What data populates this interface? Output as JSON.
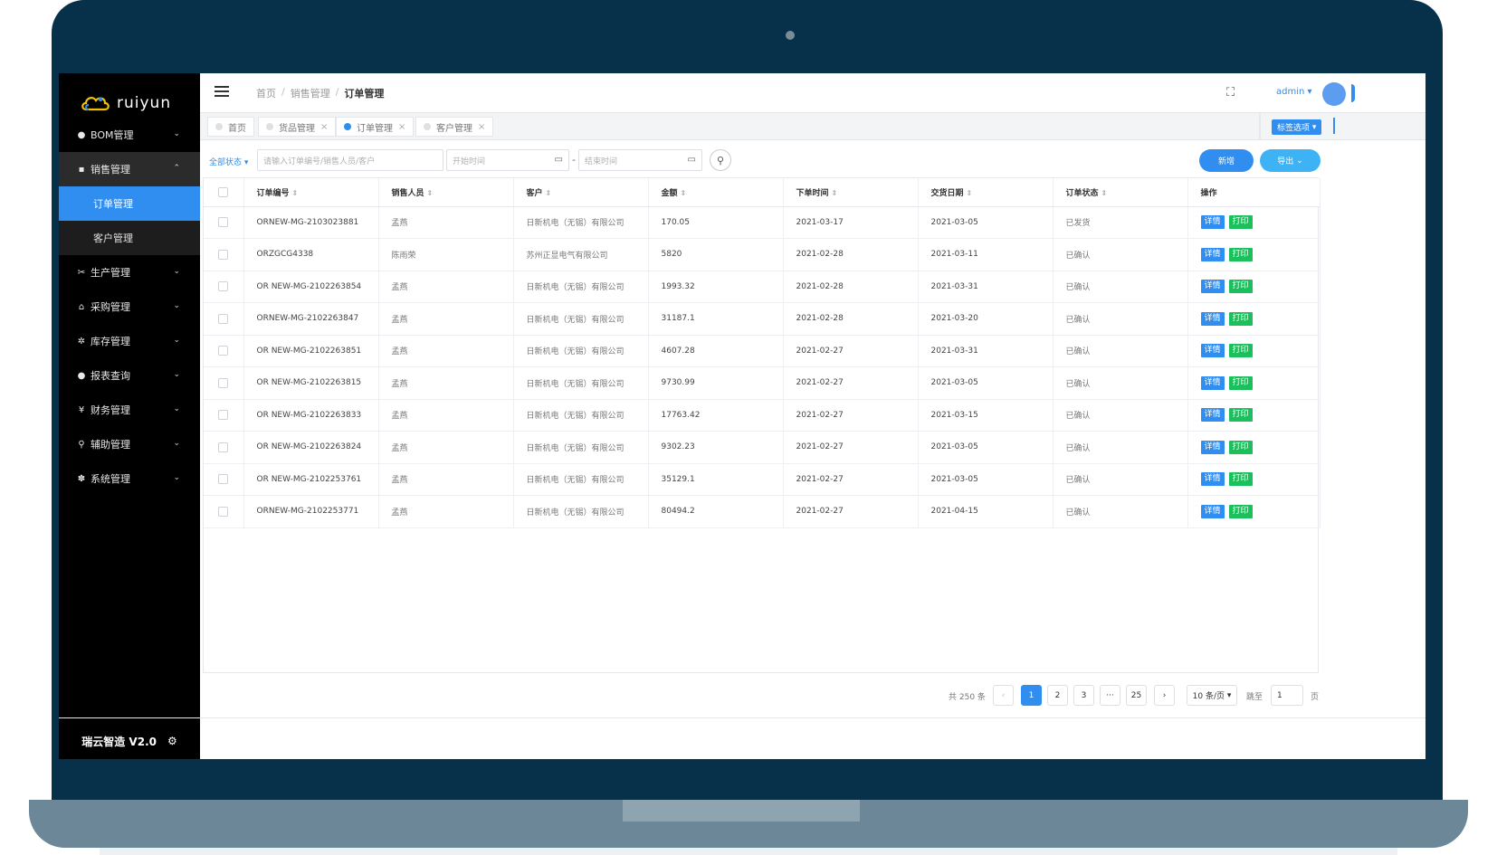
{
  "app": {
    "logo_text": "ruiyun",
    "footer_brand": "瑞云智造 V2.0"
  },
  "sidebar": {
    "items": [
      {
        "label": "BOM管理",
        "icon": "circle-icon"
      },
      {
        "label": "销售管理",
        "icon": "doc-icon",
        "children": [
          "订单管理",
          "客户管理"
        ]
      },
      {
        "label": "生产管理",
        "icon": "tools-icon"
      },
      {
        "label": "采购管理",
        "icon": "bag-icon"
      },
      {
        "label": "库存管理",
        "icon": "gear-icon"
      },
      {
        "label": "报表查询",
        "icon": "circle-icon"
      },
      {
        "label": "财务管理",
        "icon": "yen-icon"
      },
      {
        "label": "辅助管理",
        "icon": "search-icon"
      },
      {
        "label": "系统管理",
        "icon": "cluster-icon"
      }
    ]
  },
  "header": {
    "breadcrumb": [
      "首页",
      "销售管理",
      "订单管理"
    ],
    "user": "admin"
  },
  "tabs": {
    "items": [
      "首页",
      "货品管理",
      "订单管理",
      "客户管理"
    ],
    "options_label": "标签选项"
  },
  "filters": {
    "status_label": "全部状态",
    "search_placeholder": "请输入订单编号/销售人员/客户",
    "start_placeholder": "开始时间",
    "end_placeholder": "结束时间",
    "range_sep": "-",
    "add_label": "新增",
    "export_label": "导出"
  },
  "table": {
    "columns": [
      "订单编号",
      "销售人员",
      "客户",
      "金额",
      "下单时间",
      "交货日期",
      "订单状态",
      "操作"
    ],
    "detail_label": "详情",
    "print_label": "打印",
    "rows": [
      {
        "order_no": "ORNEW-MG-2103023881",
        "sales": "孟燕",
        "customer": "日新机电（无锡）有限公司",
        "amount": "170.05",
        "order_date": "2021-03-17",
        "delivery_date": "2021-03-05",
        "status": "已发货"
      },
      {
        "order_no": "ORZGCG4338",
        "sales": "陈雨荣",
        "customer": "苏州正显电气有限公司",
        "amount": "5820",
        "order_date": "2021-02-28",
        "delivery_date": "2021-03-11",
        "status": "已确认"
      },
      {
        "order_no": "OR NEW-MG-2102263854",
        "sales": "孟燕",
        "customer": "日新机电（无锡）有限公司",
        "amount": "1993.32",
        "order_date": "2021-02-28",
        "delivery_date": "2021-03-31",
        "status": "已确认"
      },
      {
        "order_no": "ORNEW-MG-2102263847",
        "sales": "孟燕",
        "customer": "日新机电（无锡）有限公司",
        "amount": "31187.1",
        "order_date": "2021-02-28",
        "delivery_date": "2021-03-20",
        "status": "已确认"
      },
      {
        "order_no": "OR NEW-MG-2102263851",
        "sales": "孟燕",
        "customer": "日新机电（无锡）有限公司",
        "amount": "4607.28",
        "order_date": "2021-02-27",
        "delivery_date": "2021-03-31",
        "status": "已确认"
      },
      {
        "order_no": "OR NEW-MG-2102263815",
        "sales": "孟燕",
        "customer": "日新机电（无锡）有限公司",
        "amount": "9730.99",
        "order_date": "2021-02-27",
        "delivery_date": "2021-03-05",
        "status": "已确认"
      },
      {
        "order_no": "OR NEW-MG-2102263833",
        "sales": "孟燕",
        "customer": "日新机电（无锡）有限公司",
        "amount": "17763.42",
        "order_date": "2021-02-27",
        "delivery_date": "2021-03-15",
        "status": "已确认"
      },
      {
        "order_no": "OR NEW-MG-2102263824",
        "sales": "孟燕",
        "customer": "日新机电（无锡）有限公司",
        "amount": "9302.23",
        "order_date": "2021-02-27",
        "delivery_date": "2021-03-05",
        "status": "已确认"
      },
      {
        "order_no": "OR NEW-MG-2102253761",
        "sales": "孟燕",
        "customer": "日新机电（无锡）有限公司",
        "amount": "35129.1",
        "order_date": "2021-02-27",
        "delivery_date": "2021-03-05",
        "status": "已确认"
      },
      {
        "order_no": "ORNEW-MG-2102253771",
        "sales": "孟燕",
        "customer": "日新机电（无锡）有限公司",
        "amount": "80494.2",
        "order_date": "2021-02-27",
        "delivery_date": "2021-04-15",
        "status": "已确认"
      }
    ]
  },
  "pagination": {
    "total_label": "共 250 条",
    "pages": [
      "1",
      "2",
      "3",
      "···",
      "25"
    ],
    "current": "1",
    "page_size": "10 条/页",
    "jump_label": "跳至",
    "jump_value": "1",
    "page_suffix": "页"
  },
  "colors": {
    "primary": "#2f8ef0",
    "success": "#1bbf5c",
    "sidebar_bg": "#000000",
    "frame": "#07304a"
  }
}
